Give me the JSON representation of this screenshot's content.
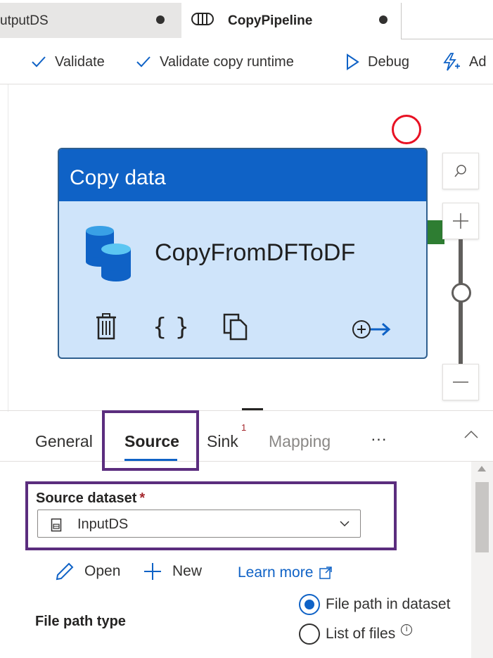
{
  "tabs": [
    {
      "label": "utputDS",
      "unsaved": true
    },
    {
      "label": "CopyPipeline",
      "unsaved": true,
      "icon": "pipeline-icon"
    }
  ],
  "toolbar": {
    "validate": "Validate",
    "validate_runtime": "Validate copy runtime",
    "debug": "Debug",
    "add_trigger": "Ad"
  },
  "activity": {
    "type_label": "Copy data",
    "name": "CopyFromDFToDF",
    "icons": [
      "delete-icon",
      "code-icon",
      "copy-icon",
      "add-output-icon"
    ]
  },
  "zoom": {
    "level": 0.5
  },
  "panel": {
    "tabs": [
      {
        "label": "General"
      },
      {
        "label": "Source",
        "active": true
      },
      {
        "label": "Sink",
        "badge": "1"
      },
      {
        "label": "Mapping",
        "disabled": true
      },
      {
        "label": "···"
      }
    ],
    "source_dataset_label": "Source dataset",
    "required_mark": "*",
    "source_dataset_value": "InputDS",
    "open_label": "Open",
    "new_label": "New",
    "learn_more_label": "Learn more",
    "file_path_type_label": "File path type",
    "file_path_options": [
      {
        "label": "File path in dataset",
        "selected": true
      },
      {
        "label": "List of files",
        "selected": false
      }
    ]
  },
  "colors": {
    "accent": "#0f62c6",
    "highlight": "#5b2d7e",
    "activity_bg": "#cfe4fa",
    "error_circle": "#e81123",
    "success_handle": "#2e7d32"
  }
}
